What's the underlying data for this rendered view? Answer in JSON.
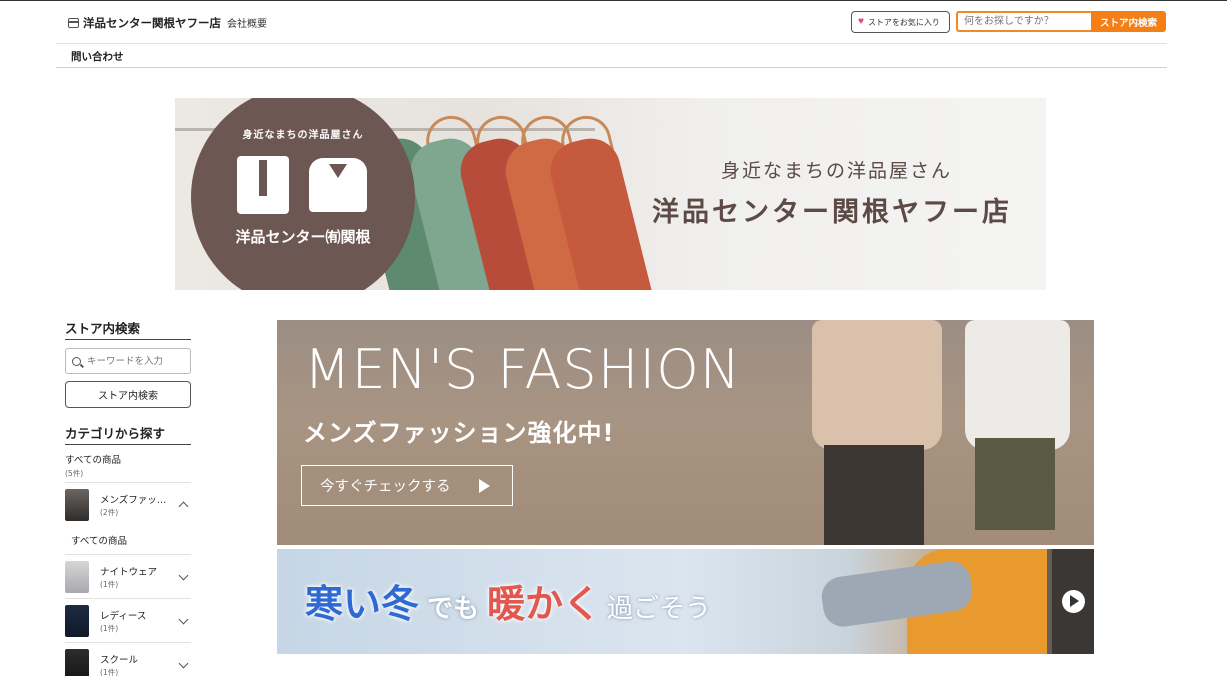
{
  "header": {
    "store_name": "洋品センター関根ヤフー店",
    "company_link": "会社概要",
    "favorite_label": "ストアをお気に入り",
    "search_placeholder": "何をお探しですか？",
    "search_button": "ストア内検索",
    "contact_link": "問い合わせ"
  },
  "main_banner": {
    "logo_top": "身近なまちの洋品屋さん",
    "logo_name": "洋品センター㈲関根",
    "subtitle": "身近なまちの洋品屋さん",
    "title": "洋品センター関根ヤフー店"
  },
  "sidebar": {
    "search_title": "ストア内検索",
    "keyword_placeholder": "キーワードを入力",
    "search_button": "ストア内検索",
    "category_title": "カテゴリから探す",
    "all_items": "すべての商品",
    "all_count": "(5件)",
    "categories": [
      {
        "label": "メンズファッ…",
        "count": "(2件)",
        "expanded": true
      },
      {
        "label": "ナイトウェア",
        "count": "(1件)",
        "expanded": false
      },
      {
        "label": "レディース",
        "count": "(1件)",
        "expanded": false
      },
      {
        "label": "スクール",
        "count": "(1件)",
        "expanded": false
      }
    ],
    "sub_all": "すべての商品"
  },
  "promo_mens": {
    "heading": "MEN'S FASHION",
    "subheading": "メンズファッション強化中!",
    "cta": "今すぐチェックする"
  },
  "promo_winter": {
    "part1": "寒い冬",
    "part2": "でも",
    "part3": "暖かく",
    "part4": "過ごそう"
  },
  "colors": {
    "accent": "#f57f17",
    "brand_brown": "#6d5752",
    "favorite_heart": "#e8407a"
  }
}
